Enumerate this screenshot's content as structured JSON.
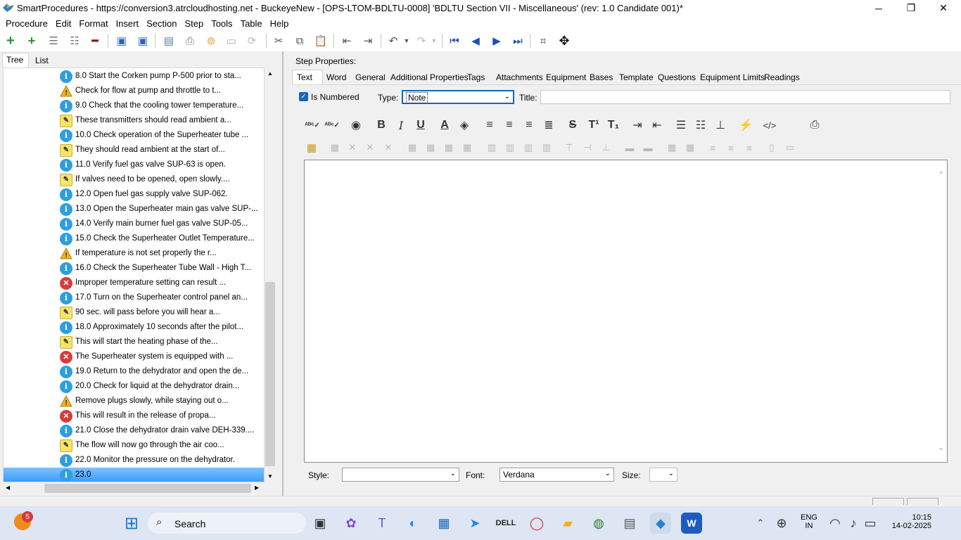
{
  "window": {
    "title": "SmartProcedures - https://conversion3.atrcloudhosting.net - BuckeyeNew - [OPS-LTOM-BDLTU-0008] 'BDLTU Section VII - Miscellaneous' (rev: 1.0 Candidate 001)*",
    "minimize": "─",
    "maximize": "❐",
    "close": "✕"
  },
  "menu": [
    "Procedure",
    "Edit",
    "Format",
    "Insert",
    "Section",
    "Step",
    "Tools",
    "Table",
    "Help"
  ],
  "left_tabs": {
    "tree": "Tree",
    "list": "List"
  },
  "tree_rows": [
    {
      "icon": "info",
      "text": "8.0 Start the Corken pump P-500 prior to sta..."
    },
    {
      "icon": "warning",
      "text": "Check for flow at pump and throttle to t..."
    },
    {
      "icon": "info",
      "text": "9.0 Check that the cooling tower temperature..."
    },
    {
      "icon": "note",
      "text": "These transmitters should read ambient a..."
    },
    {
      "icon": "info",
      "text": "10.0 Check operation of the Superheater tube ..."
    },
    {
      "icon": "note",
      "text": "They should read ambient at the start of..."
    },
    {
      "icon": "info",
      "text": "11.0 Verify fuel gas valve SUP-63 is open."
    },
    {
      "icon": "note",
      "text": "If valves need to be opened, open slowly...."
    },
    {
      "icon": "info",
      "text": "12.0 Open fuel gas supply valve SUP-062."
    },
    {
      "icon": "info",
      "text": "13.0 Open the Superheater main gas valve SUP-..."
    },
    {
      "icon": "info",
      "text": "14.0 Verify main burner fuel gas valve SUP-05..."
    },
    {
      "icon": "info",
      "text": "15.0 Check the Superheater Outlet Temperature..."
    },
    {
      "icon": "warning",
      "text": "If temperature is not set properly the r..."
    },
    {
      "icon": "info",
      "text": "16.0 Check the Superheater Tube Wall - High T..."
    },
    {
      "icon": "error",
      "text": "Improper temperature setting can result ..."
    },
    {
      "icon": "info",
      "text": "17.0 Turn on the Superheater control panel an..."
    },
    {
      "icon": "note",
      "text": "90 sec. will pass before you will hear a..."
    },
    {
      "icon": "info",
      "text": "18.0 Approximately 10 seconds after the pilot..."
    },
    {
      "icon": "note",
      "text": "This will start the heating phase of the..."
    },
    {
      "icon": "error",
      "text": "The Superheater system is equipped with ..."
    },
    {
      "icon": "info",
      "text": "19.0 Return to the dehydrator and open the de..."
    },
    {
      "icon": "info",
      "text": "20.0 Check for liquid at the dehydrator drain..."
    },
    {
      "icon": "warning",
      "text": "Remove plugs slowly, while staying out o..."
    },
    {
      "icon": "error",
      "text": "This will result in the release of propa..."
    },
    {
      "icon": "info",
      "text": "21.0 Close the dehydrator drain valve DEH-339...."
    },
    {
      "icon": "note",
      "text": "The flow will now go through the air coo..."
    },
    {
      "icon": "info",
      "text": "22.0 Monitor the pressure on the dehydrator."
    },
    {
      "icon": "info",
      "text": "23.0",
      "selected": true
    }
  ],
  "step_properties": {
    "heading": "Step Properties:",
    "tabs": [
      "Text",
      "Word",
      "General",
      "Additional Properties",
      "Tags",
      "Attachments",
      "Equipment",
      "Bases",
      "Template",
      "Questions",
      "Equipment Limits",
      "Readings"
    ],
    "is_numbered_label": "Is Numbered",
    "is_numbered": true,
    "type_label": "Type:",
    "type_value": "Note",
    "title_label": "Title:",
    "title_value": "",
    "style_label": "Style:",
    "style_value": "",
    "font_label": "Font:",
    "font_value": "Verdana",
    "size_label": "Size:",
    "size_value": ""
  },
  "taskbar": {
    "search_label": "Search",
    "notification_count": "5",
    "lang_top": "ENG",
    "lang_bottom": "IN",
    "time": "10:15",
    "date": "14-02-2025"
  },
  "colors": {
    "selection": "#3b99f5",
    "info_icon": "#2d9ee0",
    "error_icon": "#d83b3b",
    "note_icon": "#f5e36a"
  }
}
